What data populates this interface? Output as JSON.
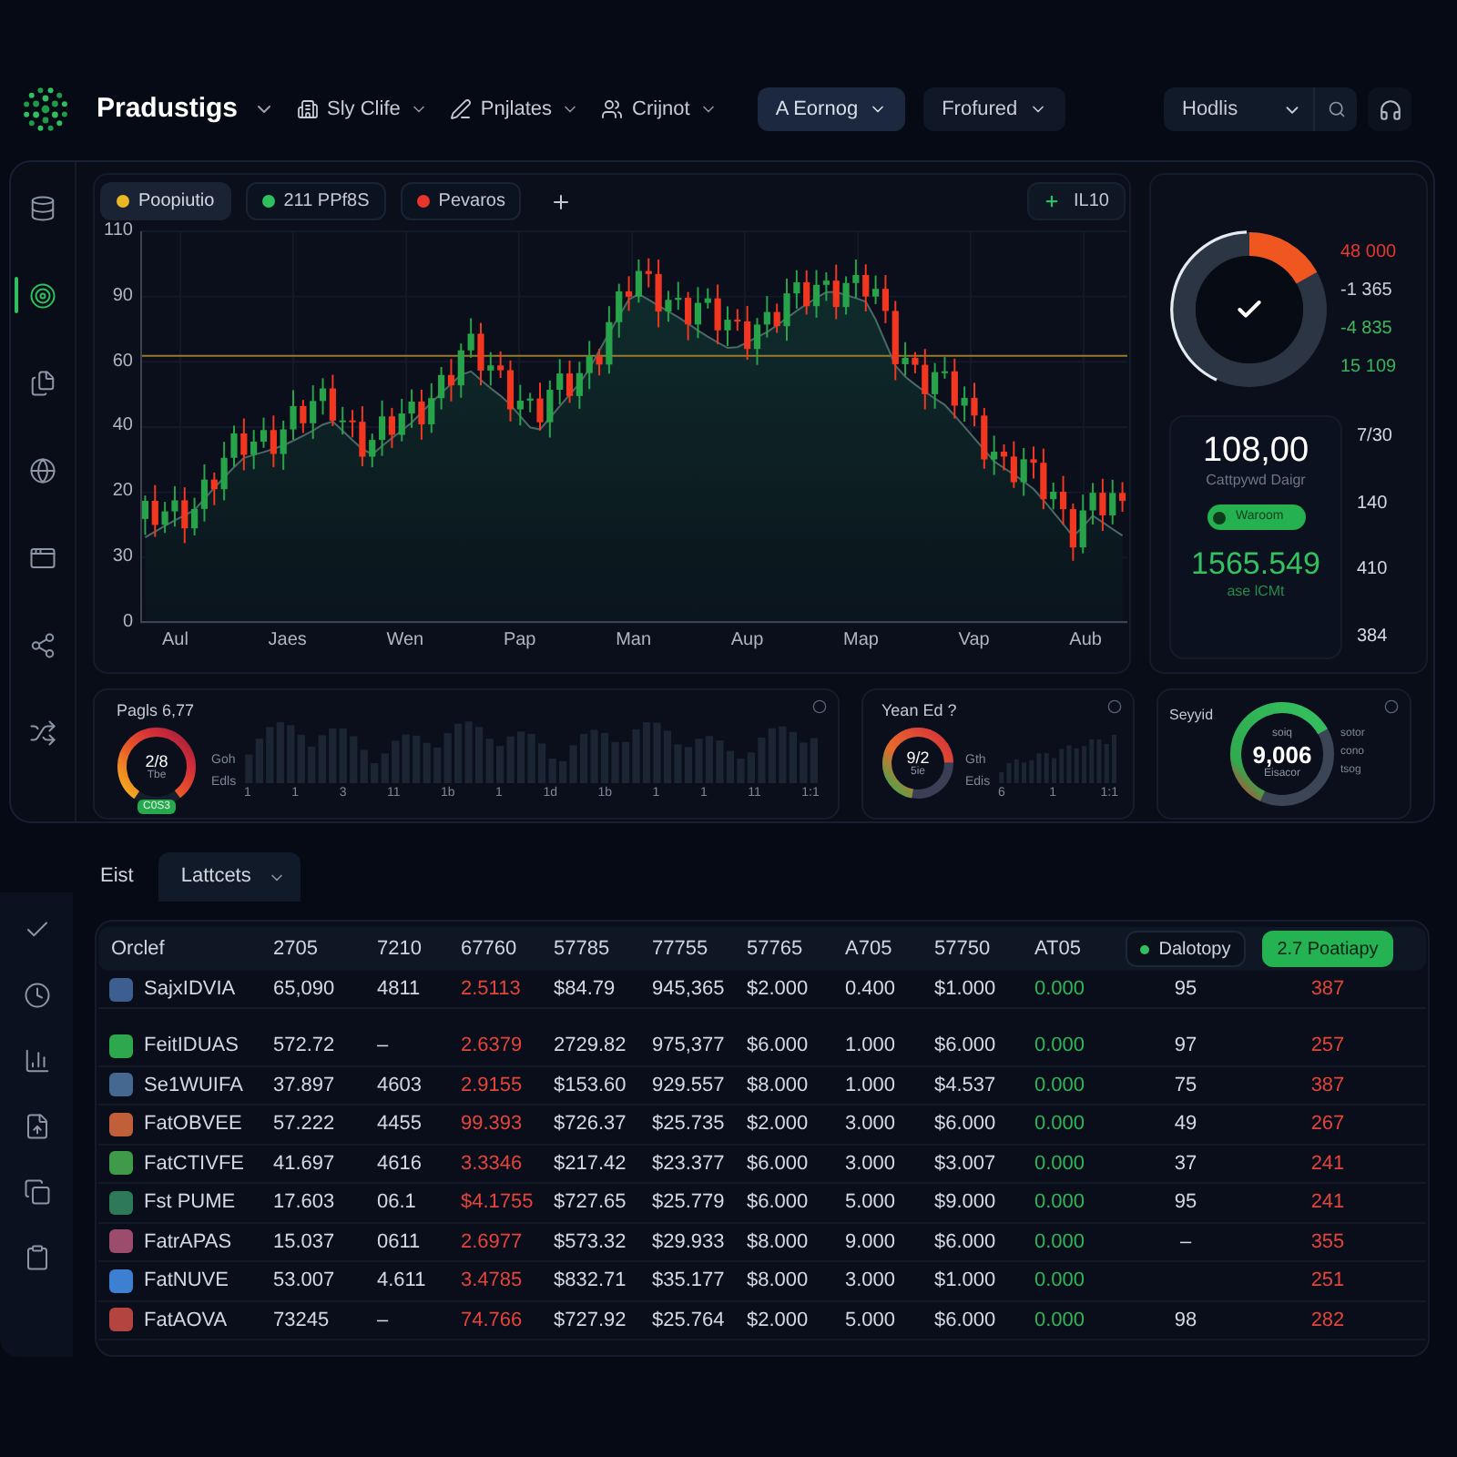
{
  "header": {
    "brand": "Pradustigs",
    "nav": [
      "Sly Clife",
      "Pnjlates",
      "Crijnot"
    ],
    "buttons": [
      {
        "label": "A Eornog",
        "selected": true
      },
      {
        "label": "Frofured",
        "selected": false
      }
    ],
    "select": {
      "value": "Hodlis"
    }
  },
  "sidebar": {
    "items": [
      {
        "selected": false
      },
      {
        "selected": true
      },
      {
        "selected": false
      },
      {
        "selected": false
      },
      {
        "selected": false
      },
      {
        "selected": false
      },
      {
        "selected": false
      }
    ]
  },
  "chart": {
    "legend": [
      {
        "label": "Poopiutio",
        "color": "#e9b824",
        "selected": true
      },
      {
        "label": "211 PPf8S",
        "color": "#2fbf5f",
        "selected": false
      },
      {
        "label": "Pevaros",
        "color": "#e8352c",
        "selected": false
      }
    ],
    "badge": "IL10",
    "y_labels": [
      "110",
      "90",
      "60",
      "40",
      "20",
      "30",
      "0"
    ],
    "x_labels": [
      "Aul",
      "Jaes",
      "Wen",
      "Pap",
      "Man",
      "Aup",
      "Map",
      "Vap",
      "Aub"
    ]
  },
  "summary": {
    "readings": [
      {
        "text": "48 000",
        "color": "#e5382f"
      },
      {
        "text": "-1 365",
        "color": "#c8d0da"
      },
      {
        "text": "-4 835",
        "color": "#3db85c"
      },
      {
        "text": "15 109",
        "color": "#39b35a"
      }
    ],
    "value": "108,00",
    "caption": "Cattpywd Daigr",
    "status": "Waroom",
    "total": "1565.549",
    "total_caption": "ase lCMt",
    "side_values": [
      "7/30",
      "140",
      "410",
      "384"
    ]
  },
  "panels": [
    {
      "kind": "bars",
      "title": "Pagls 6,77",
      "gauge": {
        "value": "2/8",
        "caption": "Tbe",
        "badge": "C0S3"
      },
      "labels": [
        "Goh",
        "Edls"
      ],
      "ticks": [
        "1",
        "1",
        "3",
        "11",
        "1b",
        "1",
        "1d",
        "1b",
        "1",
        "1",
        "11",
        "1:1"
      ]
    },
    {
      "kind": "bars",
      "title": "Yean Ed ?",
      "gauge": {
        "value": "9/2",
        "caption": "5ie"
      },
      "labels": [
        "Gth",
        "Edis"
      ],
      "ticks": [
        "6",
        "1",
        "1:1"
      ]
    },
    {
      "kind": "gauge",
      "title": "Seyyid",
      "gauge": {
        "top": "soiq",
        "value": "9,006",
        "caption": "Eisacor"
      },
      "labels": [
        "sotor",
        "cono",
        "tsog"
      ]
    }
  ],
  "tools": {
    "items": [
      {
        "selected": false
      },
      {
        "selected": false
      },
      {
        "selected": false
      },
      {
        "selected": false
      },
      {
        "selected": false
      },
      {
        "selected": false
      }
    ]
  },
  "table": {
    "filter_label": "Eist",
    "filter": "Lattcets",
    "columns": [
      {
        "label": "Orclef",
        "kind": "heading",
        "color": "#d3d9e2"
      },
      {
        "label": "2705",
        "kind": "heading",
        "color": "#d3d9e2"
      },
      {
        "label": "7210",
        "kind": "heading",
        "color": "#d3d9e2"
      },
      {
        "label": "67760",
        "kind": "heading",
        "color": "#e5443a"
      },
      {
        "label": "57785",
        "kind": "heading",
        "color": "#d3d9e2"
      },
      {
        "label": "77755",
        "kind": "heading",
        "color": "#d3d9e2"
      },
      {
        "label": "57765",
        "kind": "heading",
        "color": "#d3d9e2"
      },
      {
        "label": "A705",
        "kind": "heading",
        "color": "#d3d9e2"
      },
      {
        "label": "57750",
        "kind": "heading",
        "color": "#d3d9e2"
      },
      {
        "label": "AT05",
        "kind": "heading",
        "color": "#2fb457"
      },
      {
        "label": "Dalotopy",
        "kind": "chip",
        "color": "#d3d9e2"
      },
      {
        "label": "2.7 Poatiapy",
        "kind": "toggle",
        "color": "#e5443a"
      }
    ],
    "rows": [
      {
        "color": "#3d5f8f",
        "cells": [
          "SajxIDVIA",
          "65,090",
          "4811",
          "2.5113",
          "$84.79",
          "945,365",
          "$2.000",
          "0.400",
          "$1.000",
          "0.000",
          "95",
          "387"
        ]
      },
      {
        "color": "#2ea84c",
        "cells": [
          "FeitIDUAS",
          "572.72",
          "–",
          "2.6379",
          "2729.82",
          "975,377",
          "$6.000",
          "1.000",
          "$6.000",
          "0.000",
          "97",
          "257"
        ]
      },
      {
        "color": "#44688f",
        "cells": [
          "Se1WUIFA",
          "37.897",
          "4603",
          "2.9155",
          "$153.60",
          "929.557",
          "$8.000",
          "1.000",
          "$4.537",
          "0.000",
          "75",
          "387"
        ]
      },
      {
        "color": "#c0603a",
        "cells": [
          "FatOBVEE",
          "57.222",
          "4455",
          "99.393",
          "$726.37",
          "$25.735",
          "$2.000",
          "3.000",
          "$6.000",
          "0.000",
          "49",
          "267"
        ]
      },
      {
        "color": "#3f9a4a",
        "cells": [
          "FatCTIVFE",
          "41.697",
          "4616",
          "3.3346",
          "$217.42",
          "$23.377",
          "$6.000",
          "3.000",
          "$3.007",
          "0.000",
          "37",
          "241"
        ]
      },
      {
        "color": "#2e7a58",
        "cells": [
          "Fst PUME",
          "17.603",
          "06.1",
          "$4.1755",
          "$727.65",
          "$25.779",
          "$6.000",
          "5.000",
          "$9.000",
          "0.000",
          "95",
          "241"
        ]
      },
      {
        "color": "#9c4d6e",
        "cells": [
          "FatrAPAS",
          "15.037",
          "0611",
          "2.6977",
          "$573.32",
          "$29.933",
          "$8.000",
          "9.000",
          "$6.000",
          "0.000",
          "–",
          "355"
        ]
      },
      {
        "color": "#3d7fd0",
        "cells": [
          "FatNUVE",
          "53.007",
          "4.611",
          "3.4785",
          "$832.71",
          "$35.177",
          "$8.000",
          "3.000",
          "$1.000",
          "0.000",
          null,
          "251"
        ]
      },
      {
        "color": "#b4443f",
        "cells": [
          "FatAOVA",
          "73245",
          "–",
          "74.766",
          "$727.92",
          "$25.764",
          "$2.000",
          "5.000",
          "$6.000",
          "0.000",
          "98",
          "282"
        ]
      }
    ]
  }
}
